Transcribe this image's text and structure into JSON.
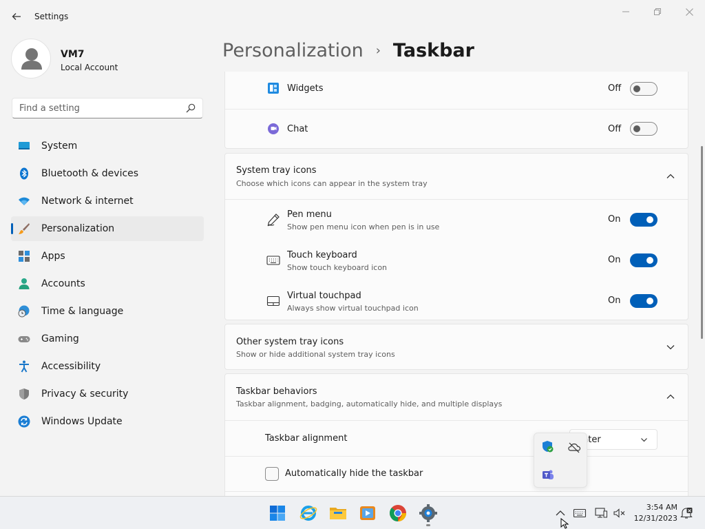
{
  "window": {
    "title": "Settings"
  },
  "user": {
    "name": "VM7",
    "account_type": "Local Account"
  },
  "search": {
    "placeholder": "Find a setting"
  },
  "nav": [
    {
      "label": "System",
      "icon": "system-icon"
    },
    {
      "label": "Bluetooth & devices",
      "icon": "bluetooth-icon"
    },
    {
      "label": "Network & internet",
      "icon": "wifi-icon"
    },
    {
      "label": "Personalization",
      "icon": "brush-icon",
      "active": true
    },
    {
      "label": "Apps",
      "icon": "apps-icon"
    },
    {
      "label": "Accounts",
      "icon": "accounts-icon"
    },
    {
      "label": "Time & language",
      "icon": "globe-clock-icon"
    },
    {
      "label": "Gaming",
      "icon": "gamepad-icon"
    },
    {
      "label": "Accessibility",
      "icon": "accessibility-icon"
    },
    {
      "label": "Privacy & security",
      "icon": "shield-icon"
    },
    {
      "label": "Windows Update",
      "icon": "update-icon"
    }
  ],
  "breadcrumb": {
    "parent": "Personalization",
    "separator": "›",
    "current": "Taskbar"
  },
  "taskbar_items": {
    "widgets": {
      "label": "Widgets",
      "state": "Off"
    },
    "chat": {
      "label": "Chat",
      "state": "Off"
    }
  },
  "system_tray_icons": {
    "title": "System tray icons",
    "description": "Choose which icons can appear in the system tray",
    "items": {
      "pen_menu": {
        "title": "Pen menu",
        "description": "Show pen menu icon when pen is in use",
        "state": "On"
      },
      "touch_keyboard": {
        "title": "Touch keyboard",
        "description": "Show touch keyboard icon",
        "state": "On"
      },
      "virtual_touchpad": {
        "title": "Virtual touchpad",
        "description": "Always show virtual touchpad icon",
        "state": "On"
      }
    }
  },
  "other_system_tray_icons": {
    "title": "Other system tray icons",
    "description": "Show or hide additional system tray icons"
  },
  "taskbar_behaviors": {
    "title": "Taskbar behaviors",
    "description": "Taskbar alignment, badging, automatically hide, and multiple displays",
    "alignment": {
      "label": "Taskbar alignment",
      "value": "nter"
    },
    "auto_hide": {
      "label": "Automatically hide the taskbar",
      "checked": false
    }
  },
  "clock": {
    "time": "3:54 AM",
    "date": "12/31/2023"
  },
  "colors": {
    "accent": "#005fb8",
    "background": "#f3f3f3",
    "card": "#fbfbfb"
  }
}
